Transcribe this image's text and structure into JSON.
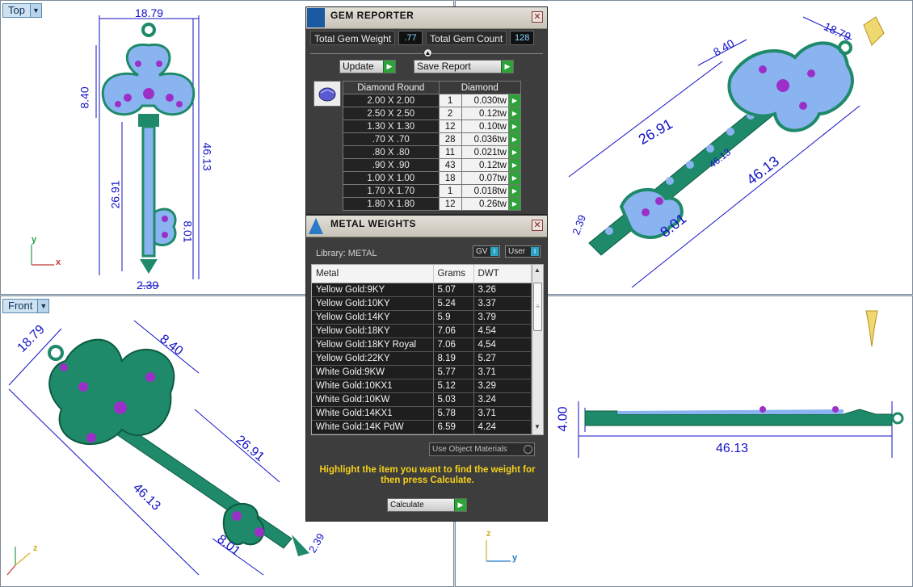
{
  "viewports": {
    "top": {
      "label": "Top",
      "dims": [
        "18.79",
        "8.40",
        "46.13",
        "26.91",
        "8.01",
        "2.39"
      ]
    },
    "front": {
      "label": "Front",
      "dims": [
        "18.79",
        "8.40",
        "26.91",
        "46.13",
        "8.01",
        "2.39"
      ]
    },
    "perspective": {
      "dims": [
        "8.40",
        "18.79",
        "26.91",
        "46.13",
        "8.01",
        "2.39",
        "46.13"
      ]
    },
    "right": {
      "dims": [
        "4.00",
        "46.13"
      ]
    },
    "axes": {
      "x": "x",
      "y": "y",
      "z": "z"
    },
    "colors": {
      "metal": "#1e8a6a",
      "stone": "#8ab4f0",
      "prong": "#9b30c8",
      "dim": "#1212c8"
    }
  },
  "gem_reporter": {
    "title": "GEM REPORTER",
    "total_weight_label": "Total Gem Weight",
    "total_weight": ".77",
    "total_count_label": "Total Gem Count",
    "total_count": "128",
    "update_label": "Update",
    "save_label": "Save Report",
    "headers": [
      "Diamond Round",
      "Diamond"
    ],
    "rows": [
      {
        "size": "2.00 X 2.00",
        "count": "1",
        "weight": "0.030tw"
      },
      {
        "size": "2.50 X 2.50",
        "count": "2",
        "weight": "0.12tw"
      },
      {
        "size": "1.30 X 1.30",
        "count": "12",
        "weight": "0.10tw"
      },
      {
        "size": ".70 X .70",
        "count": "28",
        "weight": "0.036tw"
      },
      {
        "size": ".80 X .80",
        "count": "11",
        "weight": "0.021tw"
      },
      {
        "size": ".90 X .90",
        "count": "43",
        "weight": "0.12tw"
      },
      {
        "size": "1.00 X 1.00",
        "count": "18",
        "weight": "0.07tw"
      },
      {
        "size": "1.70 X 1.70",
        "count": "1",
        "weight": "0.018tw"
      },
      {
        "size": "1.80 X 1.80",
        "count": "12",
        "weight": "0.26tw"
      }
    ]
  },
  "metal_weights": {
    "title": "METAL WEIGHTS",
    "library": "Library: METAL",
    "gv_label": "GV",
    "user_label": "User",
    "headers": [
      "Metal",
      "Grams",
      "DWT"
    ],
    "rows": [
      {
        "metal": "Yellow Gold:9KY",
        "grams": "5.07",
        "dwt": "3.26"
      },
      {
        "metal": "Yellow Gold:10KY",
        "grams": "5.24",
        "dwt": "3.37"
      },
      {
        "metal": "Yellow Gold:14KY",
        "grams": "5.9",
        "dwt": "3.79"
      },
      {
        "metal": "Yellow Gold:18KY",
        "grams": "7.06",
        "dwt": "4.54"
      },
      {
        "metal": "Yellow Gold:18KY Royal",
        "grams": "7.06",
        "dwt": "4.54"
      },
      {
        "metal": "Yellow Gold:22KY",
        "grams": "8.19",
        "dwt": "5.27"
      },
      {
        "metal": "White Gold:9KW",
        "grams": "5.77",
        "dwt": "3.71"
      },
      {
        "metal": "White Gold:10KX1",
        "grams": "5.12",
        "dwt": "3.29"
      },
      {
        "metal": "White Gold:10KW",
        "grams": "5.03",
        "dwt": "3.24"
      },
      {
        "metal": "White Gold:14KX1",
        "grams": "5.78",
        "dwt": "3.71"
      },
      {
        "metal": "White Gold:14K PdW",
        "grams": "6.59",
        "dwt": "4.24"
      }
    ],
    "use_object_label": "Use Object Materials",
    "hint": "Highlight the item you want to find the weight for then press Calculate.",
    "calculate_label": "Calculate"
  }
}
